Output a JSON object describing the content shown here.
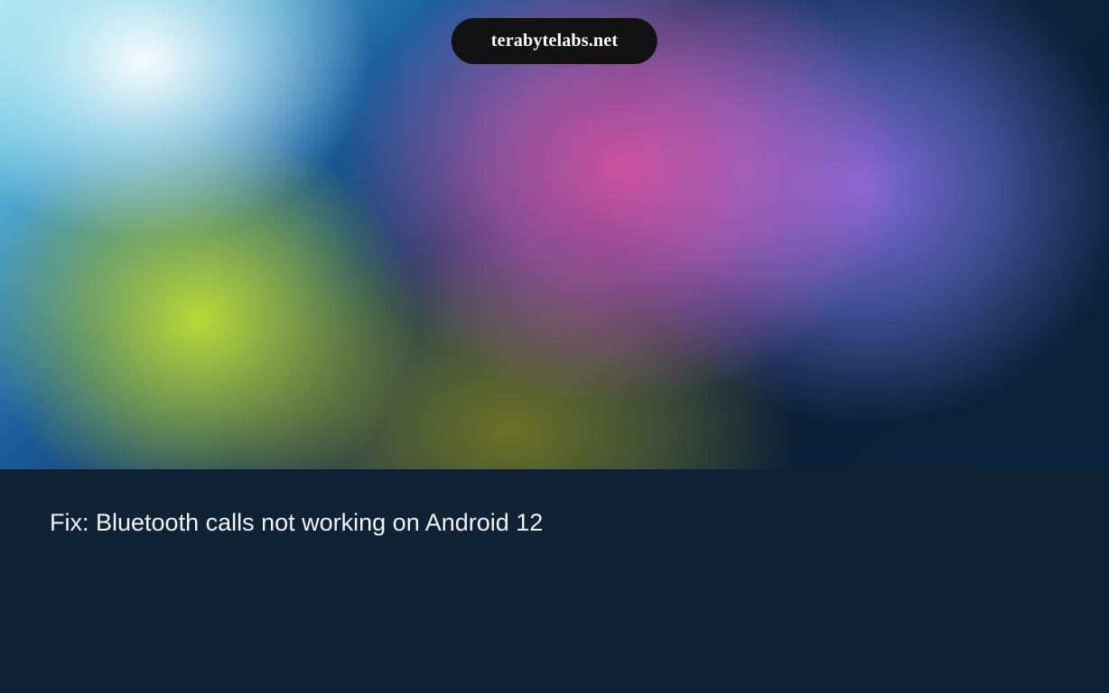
{
  "badge": {
    "label": "terabytelabs.net"
  },
  "article": {
    "caption": "Fix: Bluetooth calls not working on Android 12"
  }
}
